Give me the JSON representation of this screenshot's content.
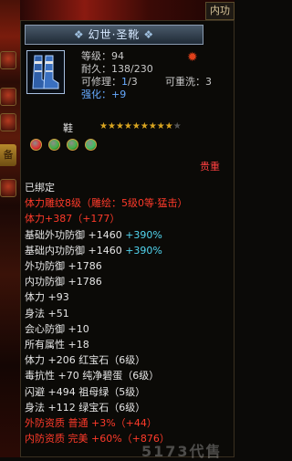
{
  "top_tab": "内功",
  "left_tab": "备",
  "item": {
    "name": "幻世·圣靴",
    "icon": "boots-icon",
    "info": [
      {
        "label": "等级",
        "value": "94"
      },
      {
        "label": "耐久",
        "value": "138/230"
      },
      {
        "label": "可修理",
        "value": "1",
        "suffix": "/3"
      },
      {
        "label": "可重洗",
        "value": "3"
      },
      {
        "label": "强化",
        "value": "+9"
      }
    ],
    "type_label": "鞋",
    "stars_filled": 9,
    "stars_total": 10,
    "gems": [
      "#e03030",
      "#40b040",
      "#40b040",
      "#40c060"
    ],
    "rarity": "贵重"
  },
  "attributes": [
    {
      "text": "已绑定",
      "cls": "c-white"
    },
    {
      "text": "体力雕纹8级（雕绘：5级0等·猛击）",
      "cls": "c-red"
    },
    {
      "text": "体力+387（+177）",
      "cls": "c-red"
    },
    {
      "parts": [
        {
          "t": "基础外功防御 +1460 ",
          "c": "c-white"
        },
        {
          "t": "+390%",
          "c": "c-cyan"
        }
      ]
    },
    {
      "parts": [
        {
          "t": "基础内功防御 +1460 ",
          "c": "c-white"
        },
        {
          "t": "+390%",
          "c": "c-cyan"
        }
      ]
    },
    {
      "text": "外功防御 +1786",
      "cls": "c-white"
    },
    {
      "text": "内功防御 +1786",
      "cls": "c-white"
    },
    {
      "text": "体力 +93",
      "cls": "c-white"
    },
    {
      "text": "身法 +51",
      "cls": "c-white"
    },
    {
      "text": "会心防御 +10",
      "cls": "c-white"
    },
    {
      "text": "所有属性 +18",
      "cls": "c-white"
    },
    {
      "text": "体力 +206 红宝石（6级）",
      "cls": "c-white"
    },
    {
      "text": "毒抗性 +70 纯净碧蛋（6级）",
      "cls": "c-white"
    },
    {
      "text": "闪避 +494 祖母绿（5级）",
      "cls": "c-white"
    },
    {
      "text": "身法 +112 绿宝石（6级）",
      "cls": "c-white"
    },
    {
      "text": "外防资质 普通 +3%（+44）",
      "cls": "c-red"
    },
    {
      "text": "内防资质 完美 +60%（+876）",
      "cls": "c-red"
    }
  ],
  "watermark": "5173代售",
  "colors": {
    "title_bg": "#2b3846",
    "accent_red": "#ff3a2a",
    "cyan": "#52d6f0",
    "blue": "#66aaff"
  }
}
